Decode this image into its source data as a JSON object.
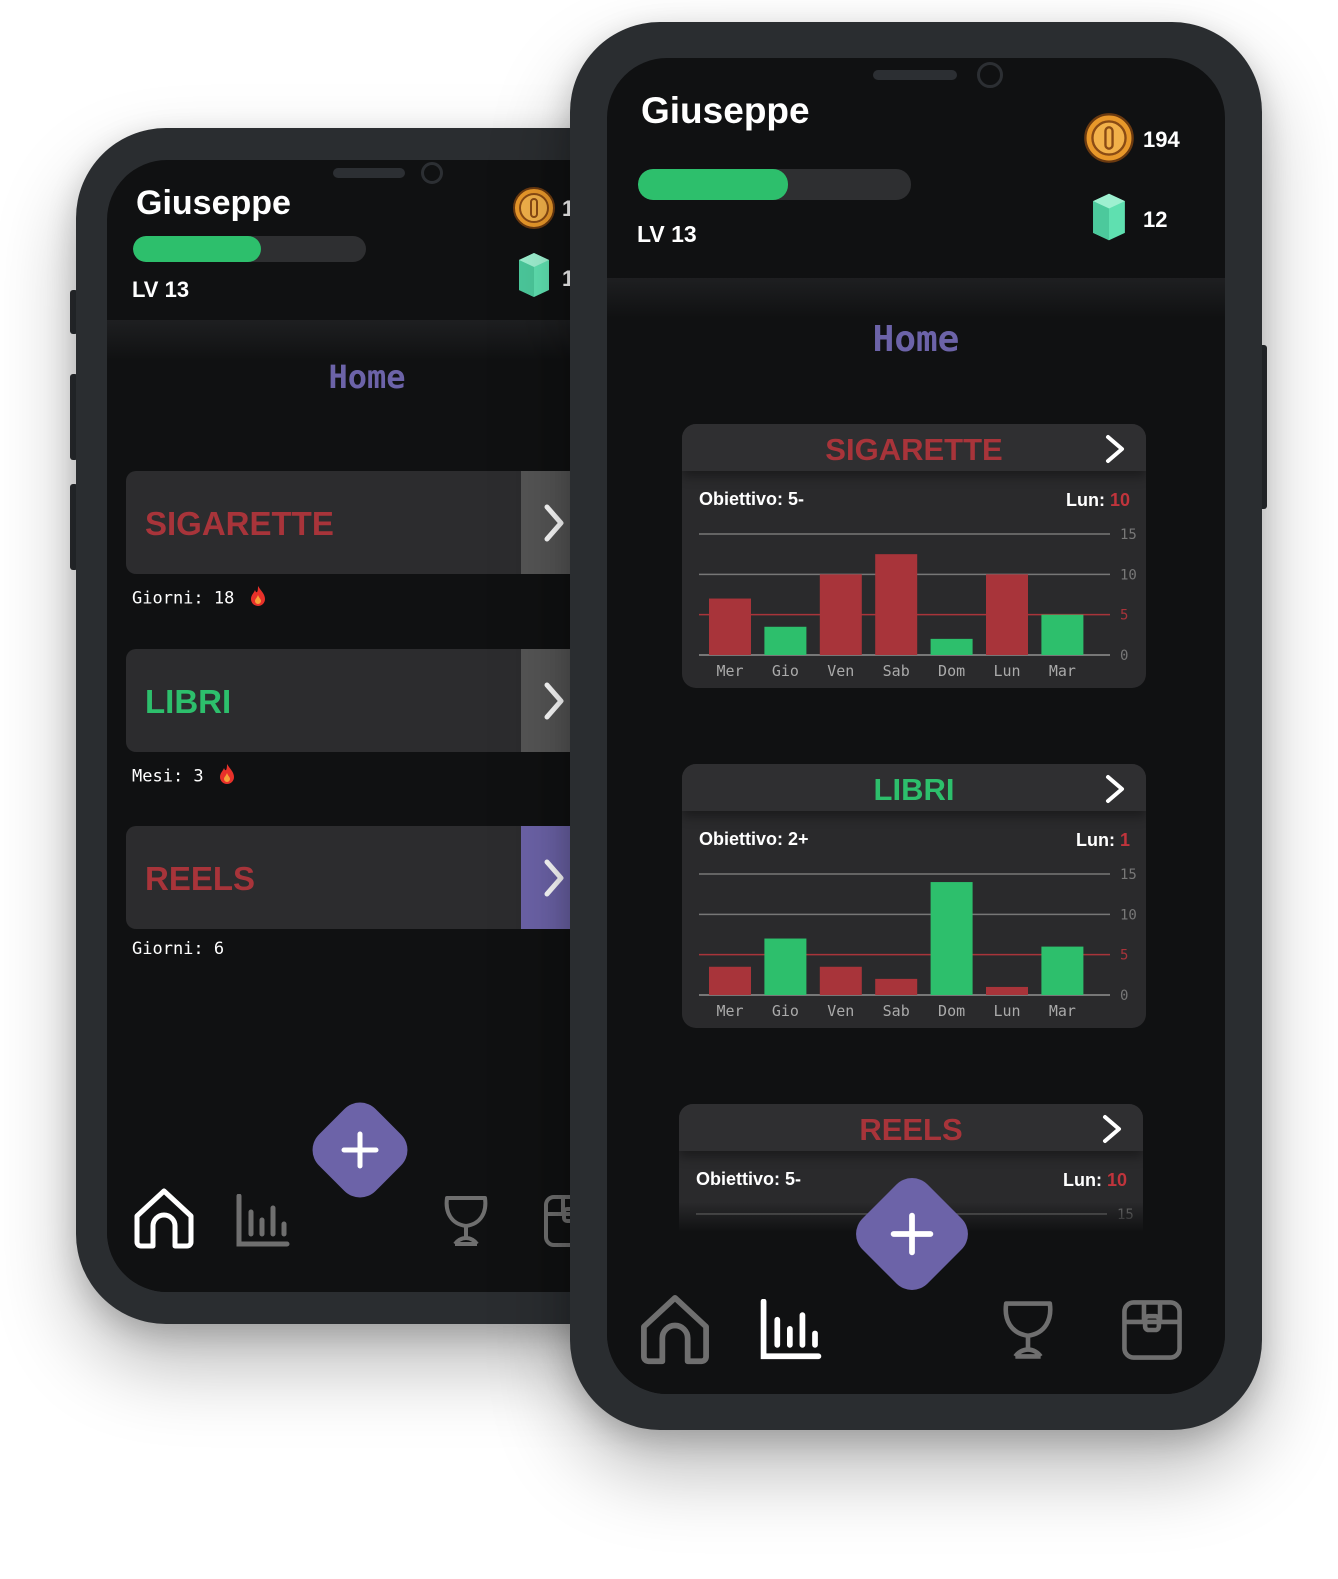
{
  "user": {
    "name": "Giuseppe",
    "level_label": "LV 13",
    "xp_progress": 0.55,
    "coins": "194",
    "gems": "12"
  },
  "page": {
    "title": "Home"
  },
  "colors": {
    "background": "#101112",
    "card": "#2c2c2e",
    "accent": "#6c63a8",
    "good": "#2dbf6c",
    "bad": "#a8343a",
    "coin": "#e8982a",
    "gem": "#5fe0b0"
  },
  "back_screen": {
    "habits": [
      {
        "name": "SIGARETTE",
        "streak_label": "Giorni: 18",
        "streak_fire": true,
        "name_color": "#a8343a",
        "arrow_bg": "#555555"
      },
      {
        "name": "LIBRI",
        "streak_label": "Mesi: 3",
        "streak_fire": true,
        "name_color": "#2dbf6c",
        "arrow_bg": "#555555"
      },
      {
        "name": "REELS",
        "streak_label": "Giorni: 6",
        "streak_fire": false,
        "name_color": "#a8343a",
        "arrow_bg": "#6c63a8"
      }
    ]
  },
  "chart_data": [
    {
      "type": "bar",
      "title": "SIGARETTE",
      "goal_label": "Obiettivo: 5-",
      "today_label": "Lun:",
      "today_value": "10",
      "categories": [
        "Mer",
        "Gio",
        "Ven",
        "Sab",
        "Dom",
        "Lun",
        "Mar"
      ],
      "values": [
        7,
        3.5,
        10,
        12.5,
        2,
        10,
        5
      ],
      "bar_colors": [
        "#a8343a",
        "#2dbf6c",
        "#a8343a",
        "#a8343a",
        "#2dbf6c",
        "#a8343a",
        "#2dbf6c"
      ],
      "target": 5,
      "ylim": [
        0,
        15
      ],
      "yticks": [
        "0",
        "5",
        "10",
        "15"
      ],
      "grid": true
    },
    {
      "type": "bar",
      "title": "LIBRI",
      "goal_label": "Obiettivo: 2+",
      "today_label": "Lun:",
      "today_value": "1",
      "categories": [
        "Mer",
        "Gio",
        "Ven",
        "Sab",
        "Dom",
        "Lun",
        "Mar"
      ],
      "values": [
        3.5,
        7,
        3.5,
        2,
        14,
        1,
        6
      ],
      "bar_colors": [
        "#a8343a",
        "#2dbf6c",
        "#a8343a",
        "#a8343a",
        "#2dbf6c",
        "#a8343a",
        "#2dbf6c"
      ],
      "target": 5,
      "ylim": [
        0,
        15
      ],
      "yticks": [
        "0",
        "5",
        "10",
        "15"
      ],
      "grid": true
    },
    {
      "type": "bar",
      "title": "REELS",
      "goal_label": "Obiettivo: 5-",
      "today_label": "Lun:",
      "today_value": "10",
      "categories": [],
      "values": [],
      "ylim": [
        0,
        15
      ],
      "yticks": [
        "15"
      ],
      "grid": true
    }
  ],
  "nav": {
    "items": [
      {
        "icon": "home-icon"
      },
      {
        "icon": "stats-icon"
      },
      {
        "icon": "add-icon"
      },
      {
        "icon": "trophy-icon"
      },
      {
        "icon": "chest-icon"
      }
    ]
  }
}
